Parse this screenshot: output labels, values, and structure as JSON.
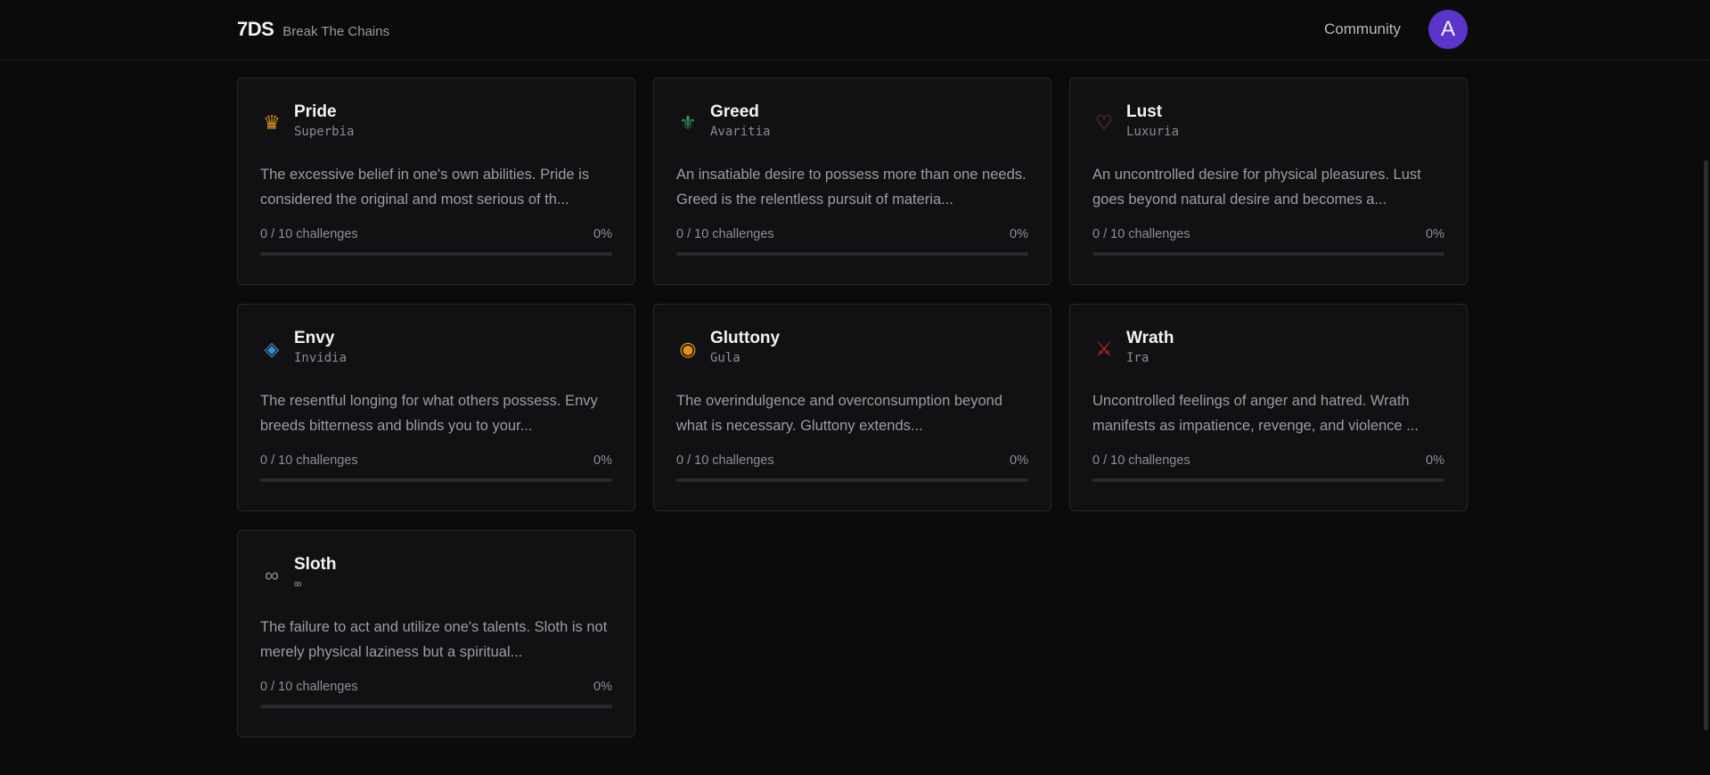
{
  "header": {
    "logo": "7DS",
    "tagline": "Break The Chains",
    "nav_community": "Community",
    "avatar_initial": "A",
    "avatar_color": "#5b34c9"
  },
  "sins": [
    {
      "name": "Pride",
      "latin": "Superbia",
      "icon": "crown-icon",
      "glyph": "♛",
      "color": "#d98a1f",
      "description": "The excessive belief in one's own abilities. Pride is considered the original and most serious of th...",
      "progress_label": "0 / 10 challenges",
      "percent_label": "0%",
      "progress": 0
    },
    {
      "name": "Greed",
      "latin": "Avaritia",
      "icon": "fleur-de-lis-icon",
      "glyph": "⚜",
      "color": "#2e9e5a",
      "description": "An insatiable desire to possess more than one needs. Greed is the relentless pursuit of materia...",
      "progress_label": "0 / 10 challenges",
      "percent_label": "0%",
      "progress": 0
    },
    {
      "name": "Lust",
      "latin": "Luxuria",
      "icon": "heart-icon",
      "glyph": "♡",
      "color": "#d13a32",
      "description": "An uncontrolled desire for physical pleasures. Lust goes beyond natural desire and becomes a...",
      "progress_label": "0 / 10 challenges",
      "percent_label": "0%",
      "progress": 0
    },
    {
      "name": "Envy",
      "latin": "Invidia",
      "icon": "diamond-icon",
      "glyph": "◈",
      "color": "#3a8fd1",
      "description": "The resentful longing for what others possess. Envy breeds bitterness and blinds you to your...",
      "progress_label": "0 / 10 challenges",
      "percent_label": "0%",
      "progress": 0
    },
    {
      "name": "Gluttony",
      "latin": "Gula",
      "icon": "circle-target-icon",
      "glyph": "◉",
      "color": "#e0921c",
      "description": "The overindulgence and overconsumption beyond what is necessary. Gluttony extends...",
      "progress_label": "0 / 10 challenges",
      "percent_label": "0%",
      "progress": 0
    },
    {
      "name": "Wrath",
      "latin": "Ira",
      "icon": "crossed-swords-icon",
      "glyph": "⚔",
      "color": "#c82a26",
      "description": "Uncontrolled feelings of anger and hatred. Wrath manifests as impatience, revenge, and violence ...",
      "progress_label": "0 / 10 challenges",
      "percent_label": "0%",
      "progress": 0
    },
    {
      "name": "Sloth",
      "latin": "∞",
      "icon": "infinity-icon",
      "glyph": "∞",
      "color": "#8e8e96",
      "description": "The failure to act and utilize one's talents. Sloth is not merely physical laziness but a spiritual...",
      "progress_label": "0 / 10 challenges",
      "percent_label": "0%",
      "progress": 0
    }
  ]
}
